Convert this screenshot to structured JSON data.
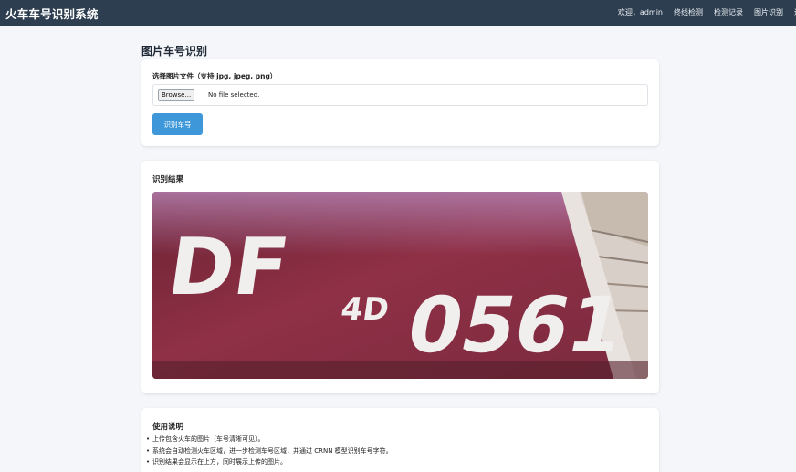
{
  "navbar": {
    "brand": "火车车号识别系统",
    "welcome": "欢迎，admin",
    "links": [
      "终线检测",
      "检测记录",
      "图片识别",
      "退"
    ]
  },
  "page": {
    "title": "图片车号识别"
  },
  "upload": {
    "label": "选择图片文件（支持 jpg, jpeg, png）",
    "browse_label": "Browse...",
    "file_status": "No file selected.",
    "submit_label": "识别车号"
  },
  "result": {
    "title": "识别结果",
    "image_text": {
      "main": "DF",
      "sub": "4D",
      "number": "0561"
    },
    "colors": {
      "body": "#8c2f44",
      "band": "#e9e3df",
      "stencil": "#f1eeee"
    }
  },
  "help": {
    "title": "使用说明",
    "items": [
      "上传包含火车的图片（车号清晰可见）。",
      "系统会自动检测火车区域，进一步检测车号区域，并通过 CRNN 模型识别车号字符。",
      "识别结果会显示在上方，同时展示上传的图片。"
    ]
  }
}
